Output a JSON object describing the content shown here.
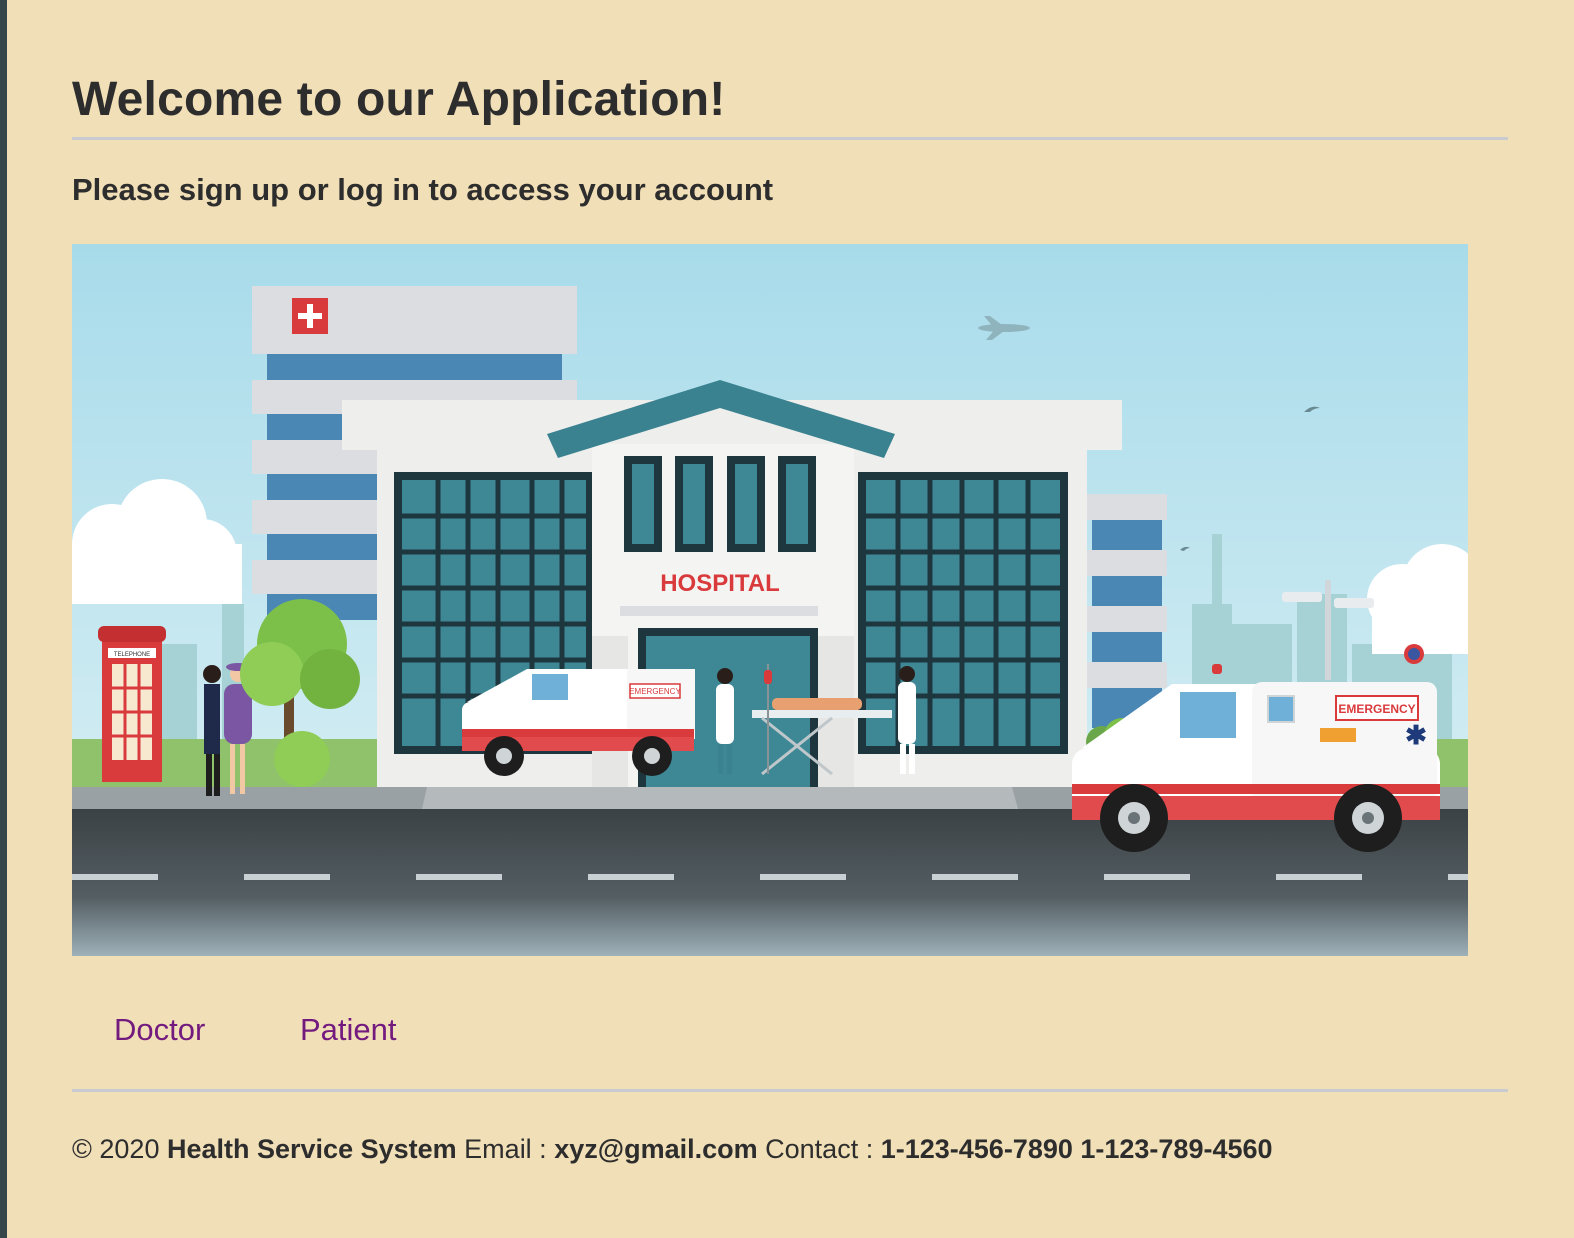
{
  "page": {
    "title": "Welcome to our Application!",
    "subtitle": "Please sign up or log in to access your account"
  },
  "hero": {
    "sign_text": "HOSPITAL",
    "ambulance_small_label": "EMERGENCY",
    "ambulance_large_label": "EMERGENCY",
    "phonebooth_label": "TELEPHONE"
  },
  "nav": {
    "doctor_label": "Doctor",
    "patient_label": "Patient"
  },
  "footer": {
    "copyright": "© 2020",
    "brand": "Health Service System",
    "email_label": "Email :",
    "email": "xyz@gmail.com",
    "contact_label": "Contact :",
    "phones": "1-123-456-7890 1-123-789-4560"
  },
  "colors": {
    "background": "#f1dfb7",
    "link": "#731a7f",
    "text": "#2d2d2d",
    "rule": "#c9cbd0"
  }
}
